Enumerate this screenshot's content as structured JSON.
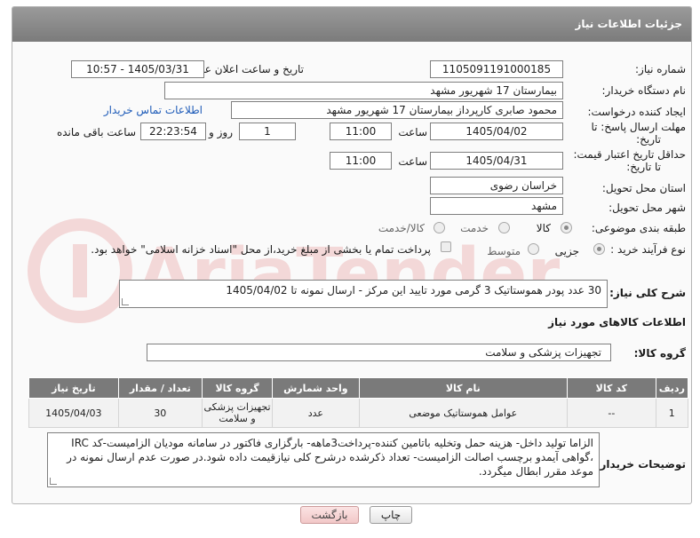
{
  "header": {
    "title": "جزئیات اطلاعات نیاز"
  },
  "fields": {
    "need_number": {
      "label": "شماره نیاز:",
      "value": "1105091191000185"
    },
    "announce_datetime": {
      "label": "تاریخ و ساعت اعلان عمومی:",
      "value": "1405/03/31 - 10:57"
    },
    "buyer_org": {
      "label": "نام دستگاه خریدار:",
      "value": "بیمارستان 17 شهریور مشهد"
    },
    "requester": {
      "label": "ایجاد کننده درخواست:",
      "value": "محمود صابری کارپرداز بیمارستان 17 شهریور مشهد",
      "contact_link": "اطلاعات تماس خریدار"
    },
    "reply_deadline": {
      "label_line1": "مهلت ارسال پاسخ: تا",
      "label_line2": "تاریخ:",
      "date": "1405/04/02",
      "time_label": "ساعت",
      "time": "11:00",
      "days": "1",
      "days_label": "روز و",
      "remaining": "22:23:54",
      "remaining_label": "ساعت باقی مانده"
    },
    "price_validity": {
      "label_line1": "حداقل تاریخ اعتبار قیمت:",
      "label_line2": "تا تاریخ:",
      "date": "1405/04/31",
      "time_label": "ساعت",
      "time": "11:00"
    },
    "delivery_province": {
      "label": "استان محل تحویل:",
      "value": "خراسان رضوی"
    },
    "delivery_city": {
      "label": "شهر محل تحویل:",
      "value": "مشهد"
    },
    "category": {
      "label": "طبقه بندی موضوعی:",
      "options": [
        "کالا",
        "خدمت",
        "کالا/خدمت"
      ],
      "selected": "کالا"
    },
    "process_type": {
      "label": "نوع فرآیند خرید :",
      "options": [
        "جزیی",
        "متوسط"
      ],
      "selected": "جزیی",
      "payment_note": "پرداخت تمام یا بخشی از مبلغ خرید،از محل \"اسناد خزانه اسلامی\" خواهد بود."
    }
  },
  "summary": {
    "label": "شرح کلی نیاز:",
    "value": "30 عدد پودر هموستاتیک 3 گرمی مورد تایید این مرکز - ارسال نمونه تا 1405/04/02"
  },
  "goods_section": {
    "title": "اطلاعات کالاهای مورد نیاز",
    "group_label": "گروه کالا:",
    "group_value": "تجهیزات پزشکی و سلامت"
  },
  "goods_table": {
    "columns": [
      "ردیف",
      "کد کالا",
      "نام کالا",
      "واحد شمارش",
      "گروه کالا",
      "تعداد / مقدار",
      "تاریخ نیاز"
    ],
    "rows": [
      {
        "row": "1",
        "code": "--",
        "name": "عوامل هموستاتیک موضعی",
        "unit": "عدد",
        "group": "تجهیزات پزشکی و سلامت",
        "qty": "30",
        "date": "1405/04/03"
      }
    ]
  },
  "buyer_notes": {
    "label": "توضیحات خریدار:",
    "value": "الزاما تولید داخل- هزینه حمل وتخلیه باتامین کننده-پرداخت3ماهه- بارگزاری فاکتور در سامانه مودیان الزامیست-کد IRC ،گواهی آیمدو برچسب اصالت الزامیست- تعداد ذکرشده درشرح کلی نیازقیمت داده شود.در صورت عدم ارسال نمونه در موعد مقرر ابطال میگردد."
  },
  "buttons": {
    "print": "چاپ",
    "back": "بازگشت"
  },
  "watermark_text": "AriaTender.net",
  "colors": {
    "header_bg": "#8a8a8a",
    "table_header_bg": "#7a7a7a",
    "link": "#1e5bb8",
    "back_button_bg": "#f2c8c8"
  }
}
